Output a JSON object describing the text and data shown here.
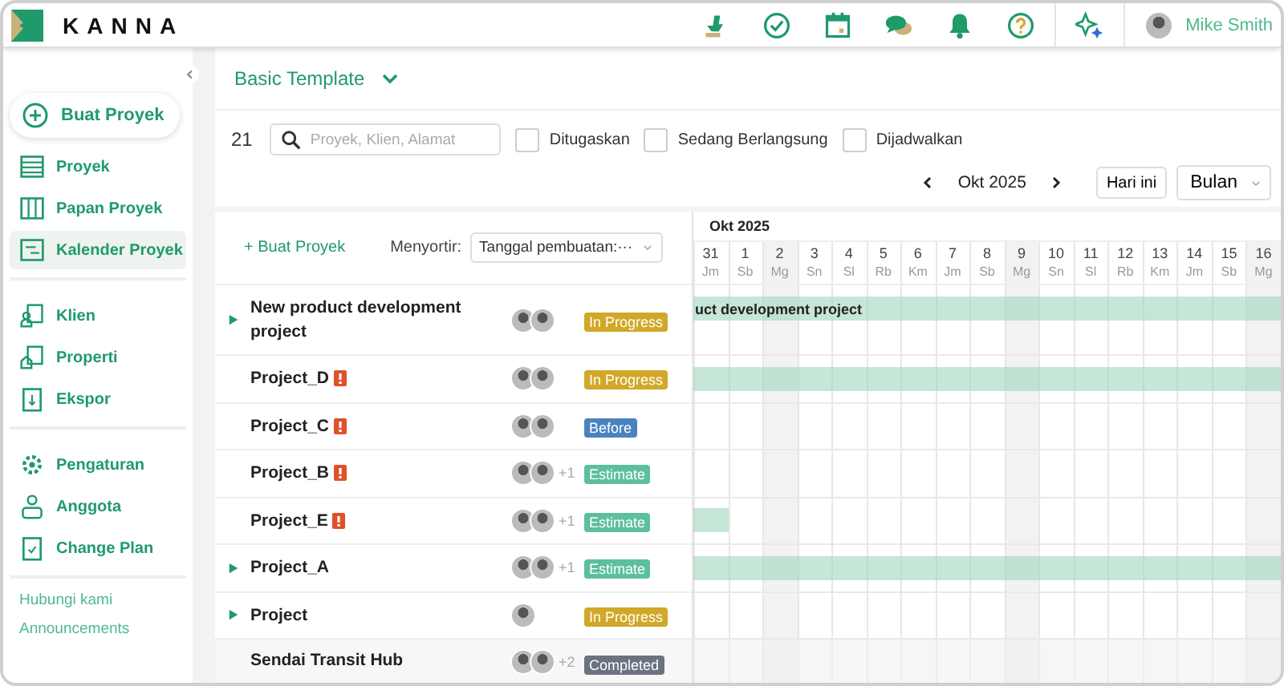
{
  "brand": "KANNA",
  "user": {
    "name": "Mike Smith"
  },
  "sidebar": {
    "create_button": "Buat Proyek",
    "groups": [
      {
        "items": [
          {
            "label": "Proyek",
            "selected": false
          },
          {
            "label": "Papan Proyek",
            "selected": false
          },
          {
            "label": "Kalender Proyek",
            "selected": true
          }
        ]
      },
      {
        "items": [
          {
            "label": "Klien",
            "selected": false
          },
          {
            "label": "Properti",
            "selected": false
          },
          {
            "label": "Ekspor",
            "selected": false
          }
        ]
      },
      {
        "items": [
          {
            "label": "Pengaturan",
            "selected": false
          },
          {
            "label": "Anggota",
            "selected": false
          },
          {
            "label": "Change Plan",
            "selected": false
          }
        ]
      }
    ],
    "links": [
      "Hubungi kami",
      "Announcements"
    ]
  },
  "template": {
    "title": "Basic Template"
  },
  "filters": {
    "count": "21",
    "search": {
      "placeholder": "Proyek, Klien, Alamat"
    },
    "checkboxes": [
      {
        "label": "Ditugaskan",
        "checked": false
      },
      {
        "label": "Sedang Berlangsung",
        "checked": false
      },
      {
        "label": "Dijadwalkan",
        "checked": false
      }
    ]
  },
  "navigator": {
    "period": "Okt 2025",
    "today_button": "Hari ini",
    "view": "Bulan"
  },
  "list": {
    "create_link": "+ Buat Proyek",
    "sort_label": "Menyortir:",
    "sort_value": "Tanggal pembuatan:···",
    "rows": [
      {
        "name": "New product development project",
        "expandable": true,
        "alert": false,
        "avatars": [
          {
            "kind": "person"
          },
          {
            "kind": "person"
          }
        ],
        "status": "In Progress",
        "color": "#d1a827",
        "bar": {
          "level": 1,
          "label": "uct development project"
        }
      },
      {
        "name": "Project_D",
        "expandable": false,
        "alert": true,
        "avatars": [
          {
            "kind": "person"
          },
          {
            "kind": "person"
          }
        ],
        "status": "In Progress",
        "color": "#d1a827",
        "bar": {
          "level": 1
        }
      },
      {
        "name": "Project_C",
        "expandable": false,
        "alert": true,
        "avatars": [
          {
            "kind": "person"
          },
          {
            "kind": "person"
          }
        ],
        "status": "Before",
        "color": "#4a82c0"
      },
      {
        "name": "Project_B",
        "expandable": false,
        "alert": true,
        "avatars": [
          {
            "kind": "person"
          },
          {
            "kind": "person"
          }
        ],
        "extra": "+1",
        "status": "Estimate",
        "color": "#5cbf9d"
      },
      {
        "name": "Project_E",
        "expandable": false,
        "alert": true,
        "avatars": [
          {
            "kind": "person"
          },
          {
            "kind": "person"
          }
        ],
        "extra": "+1",
        "status": "Estimate",
        "color": "#5cbf9d",
        "bar": {
          "level": 0.06
        }
      },
      {
        "name": "Project_A",
        "expandable": true,
        "alert": false,
        "avatars": [
          {
            "kind": "person"
          },
          {
            "kind": "person"
          }
        ],
        "extra": "+1",
        "status": "Estimate",
        "color": "#5cbf9d",
        "bar": {
          "level": 1
        }
      },
      {
        "name": "Project",
        "expandable": true,
        "alert": false,
        "avatars": [
          {
            "kind": "person"
          }
        ],
        "status": "In Progress",
        "color": "#d1a827"
      },
      {
        "name": "Sendai Transit Hub",
        "expandable": false,
        "alert": false,
        "avatars": [
          {
            "kind": "person"
          },
          {
            "kind": "person"
          }
        ],
        "extra": "+2",
        "status": "Completed",
        "color": "#6b7280"
      }
    ]
  },
  "gantt": {
    "month": "Okt 2025",
    "days": [
      {
        "date": "31",
        "weekday": "Jm",
        "shaded": false
      },
      {
        "date": "1",
        "weekday": "Sb",
        "shaded": false
      },
      {
        "date": "2",
        "weekday": "Mg",
        "shaded": true
      },
      {
        "date": "3",
        "weekday": "Sn",
        "shaded": false
      },
      {
        "date": "4",
        "weekday": "Sl",
        "shaded": false
      },
      {
        "date": "5",
        "weekday": "Rb",
        "shaded": false
      },
      {
        "date": "6",
        "weekday": "Km",
        "shaded": false
      },
      {
        "date": "7",
        "weekday": "Jm",
        "shaded": false
      },
      {
        "date": "8",
        "weekday": "Sb",
        "shaded": false
      },
      {
        "date": "9",
        "weekday": "Mg",
        "shaded": true
      },
      {
        "date": "10",
        "weekday": "Sn",
        "shaded": false
      },
      {
        "date": "11",
        "weekday": "Sl",
        "shaded": false
      },
      {
        "date": "12",
        "weekday": "Rb",
        "shaded": false
      },
      {
        "date": "13",
        "weekday": "Km",
        "shaded": false
      },
      {
        "date": "14",
        "weekday": "Jm",
        "shaded": false
      },
      {
        "date": "15",
        "weekday": "Sb",
        "shaded": false
      },
      {
        "date": "16",
        "weekday": "Mg",
        "shaded": true
      }
    ]
  }
}
